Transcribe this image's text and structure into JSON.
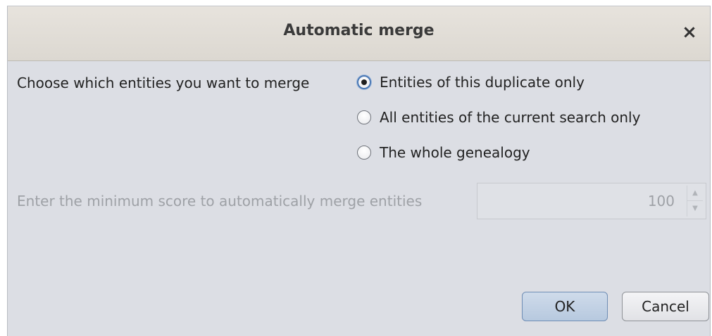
{
  "dialog": {
    "title": "Automatic merge",
    "close_glyph": "×"
  },
  "merge_scope": {
    "label": "Choose which entities you want to merge",
    "options": [
      {
        "label": "Entities of this duplicate only",
        "selected": true
      },
      {
        "label": "All entities of the current search only",
        "selected": false
      },
      {
        "label": "The whole genealogy",
        "selected": false
      }
    ]
  },
  "min_score": {
    "label": "Enter the minimum score to automatically merge entities",
    "value": "100",
    "enabled": false,
    "up_glyph": "▲",
    "down_glyph": "▼"
  },
  "buttons": {
    "ok_label": "OK",
    "cancel_label": "Cancel"
  },
  "colors": {
    "dialog_background": "#dcdee4",
    "titlebar_background": "#e2ded8",
    "selected_radio_border": "#4a78b5",
    "ok_button_fill": "#c3d3e6"
  },
  "icons": {
    "close": "close-icon",
    "spinner_up": "chevron-up-icon",
    "spinner_down": "chevron-down-icon"
  }
}
